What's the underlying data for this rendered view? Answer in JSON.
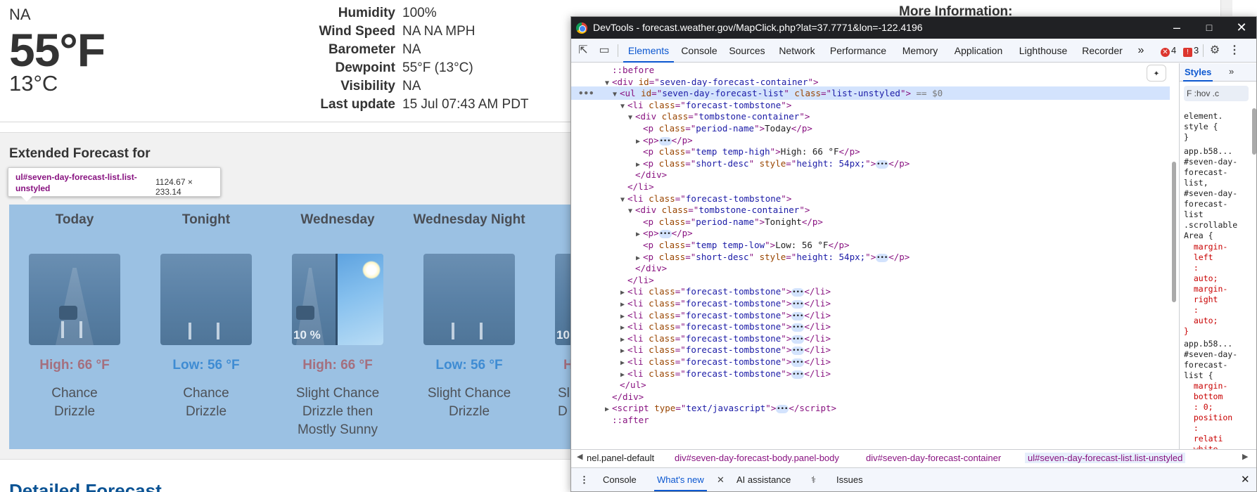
{
  "current": {
    "condition": "NA",
    "temp_f": "55°F",
    "temp_c": "13°C",
    "details": [
      {
        "label": "Humidity",
        "value": "100%"
      },
      {
        "label": "Wind Speed",
        "value": "NA NA MPH"
      },
      {
        "label": "Barometer",
        "value": "NA"
      },
      {
        "label": "Dewpoint",
        "value": "55°F (13°C)"
      },
      {
        "label": "Visibility",
        "value": "NA"
      },
      {
        "label": "Last update",
        "value": "15 Jul 07:43 AM PDT"
      }
    ],
    "more_info": "More Information:"
  },
  "extended": {
    "title": "Extended Forecast for",
    "tooltip_selector": "ul#seven-day-forecast-list.list-unstyled",
    "tooltip_size": "1124.67 × 233.14",
    "periods": [
      {
        "name": "Today",
        "temp": "High: 66 °F",
        "temp_type": "high",
        "desc": "Chance Drizzle",
        "pop": ""
      },
      {
        "name": "Tonight",
        "temp": "Low: 56 °F",
        "temp_type": "low",
        "desc": "Chance Drizzle",
        "pop": ""
      },
      {
        "name": "Wednesday",
        "temp": "High: 66 °F",
        "temp_type": "high",
        "desc": "Slight Chance Drizzle then Mostly Sunny",
        "pop": "10 %"
      },
      {
        "name": "Wednesday Night",
        "temp": "Low: 56 °F",
        "temp_type": "low",
        "desc": "Slight Chance Drizzle",
        "pop": ""
      },
      {
        "name": "",
        "temp": "H",
        "temp_type": "high",
        "desc": "Sl D",
        "pop": "10"
      }
    ]
  },
  "detailed": {
    "title": "Detailed Forecast"
  },
  "devtools": {
    "window_title": "DevTools - forecast.weather.gov/MapClick.php?lat=37.7771&lon=-122.4196",
    "tabs": [
      "Elements",
      "Console",
      "Sources",
      "Network",
      "Performance",
      "Memory",
      "Application",
      "Lighthouse",
      "Recorder"
    ],
    "more_tabs": "»",
    "error_count": "4",
    "issue_count": "3",
    "dom_lines": [
      {
        "indent": 4,
        "tw": "",
        "html": "::before",
        "sel": false,
        "kind": "pseudo"
      },
      {
        "indent": 4,
        "tw": "▼",
        "tag": "div",
        "attrs": [
          [
            "id",
            "seven-day-forecast-container"
          ]
        ],
        "end": false,
        "sel": false
      },
      {
        "indent": 5,
        "tw": "▼",
        "tag": "ul",
        "attrs": [
          [
            "id",
            "seven-day-forecast-list"
          ],
          [
            "class",
            "list-unstyled"
          ]
        ],
        "end": false,
        "sel": true,
        "suffix": " == $0"
      },
      {
        "indent": 6,
        "tw": "▼",
        "tag": "li",
        "attrs": [
          [
            "class",
            "forecast-tombstone"
          ]
        ],
        "end": false,
        "sel": false
      },
      {
        "indent": 7,
        "tw": "▼",
        "tag": "div",
        "attrs": [
          [
            "class",
            "tombstone-container"
          ]
        ],
        "end": false,
        "sel": false
      },
      {
        "indent": 8,
        "tw": "",
        "tag": "p",
        "attrs": [
          [
            "class",
            "period-name"
          ]
        ],
        "text": "Today",
        "close": "p",
        "sel": false
      },
      {
        "indent": 8,
        "tw": "▶",
        "tag": "p",
        "attrs": [],
        "pill": true,
        "close": "p",
        "sel": false
      },
      {
        "indent": 8,
        "tw": "",
        "tag": "p",
        "attrs": [
          [
            "class",
            "temp temp-high"
          ]
        ],
        "text": "High: 66 °F",
        "close": "p",
        "sel": false
      },
      {
        "indent": 8,
        "tw": "▶",
        "tag": "p",
        "attrs": [
          [
            "class",
            "short-desc"
          ],
          [
            "style",
            "height: 54px;"
          ]
        ],
        "pill": true,
        "close": "p",
        "sel": false
      },
      {
        "indent": 7,
        "tw": "",
        "closeonly": "div",
        "sel": false
      },
      {
        "indent": 6,
        "tw": "",
        "closeonly": "li",
        "sel": false
      },
      {
        "indent": 6,
        "tw": "▼",
        "tag": "li",
        "attrs": [
          [
            "class",
            "forecast-tombstone"
          ]
        ],
        "end": false,
        "sel": false
      },
      {
        "indent": 7,
        "tw": "▼",
        "tag": "div",
        "attrs": [
          [
            "class",
            "tombstone-container"
          ]
        ],
        "end": false,
        "sel": false
      },
      {
        "indent": 8,
        "tw": "",
        "tag": "p",
        "attrs": [
          [
            "class",
            "period-name"
          ]
        ],
        "text": "Tonight",
        "close": "p",
        "sel": false
      },
      {
        "indent": 8,
        "tw": "▶",
        "tag": "p",
        "attrs": [],
        "pill": true,
        "close": "p",
        "sel": false
      },
      {
        "indent": 8,
        "tw": "",
        "tag": "p",
        "attrs": [
          [
            "class",
            "temp temp-low"
          ]
        ],
        "text": "Low: 56 °F",
        "close": "p",
        "sel": false
      },
      {
        "indent": 8,
        "tw": "▶",
        "tag": "p",
        "attrs": [
          [
            "class",
            "short-desc"
          ],
          [
            "style",
            "height: 54px;"
          ]
        ],
        "pill": true,
        "close": "p",
        "sel": false
      },
      {
        "indent": 7,
        "tw": "",
        "closeonly": "div",
        "sel": false
      },
      {
        "indent": 6,
        "tw": "",
        "closeonly": "li",
        "sel": false
      },
      {
        "indent": 6,
        "tw": "▶",
        "tag": "li",
        "attrs": [
          [
            "class",
            "forecast-tombstone"
          ]
        ],
        "pill": true,
        "close": "li",
        "sel": false
      },
      {
        "indent": 6,
        "tw": "▶",
        "tag": "li",
        "attrs": [
          [
            "class",
            "forecast-tombstone"
          ]
        ],
        "pill": true,
        "close": "li",
        "sel": false
      },
      {
        "indent": 6,
        "tw": "▶",
        "tag": "li",
        "attrs": [
          [
            "class",
            "forecast-tombstone"
          ]
        ],
        "pill": true,
        "close": "li",
        "sel": false
      },
      {
        "indent": 6,
        "tw": "▶",
        "tag": "li",
        "attrs": [
          [
            "class",
            "forecast-tombstone"
          ]
        ],
        "pill": true,
        "close": "li",
        "sel": false
      },
      {
        "indent": 6,
        "tw": "▶",
        "tag": "li",
        "attrs": [
          [
            "class",
            "forecast-tombstone"
          ]
        ],
        "pill": true,
        "close": "li",
        "sel": false
      },
      {
        "indent": 6,
        "tw": "▶",
        "tag": "li",
        "attrs": [
          [
            "class",
            "forecast-tombstone"
          ]
        ],
        "pill": true,
        "close": "li",
        "sel": false
      },
      {
        "indent": 6,
        "tw": "▶",
        "tag": "li",
        "attrs": [
          [
            "class",
            "forecast-tombstone"
          ]
        ],
        "pill": true,
        "close": "li",
        "sel": false
      },
      {
        "indent": 6,
        "tw": "▶",
        "tag": "li",
        "attrs": [
          [
            "class",
            "forecast-tombstone"
          ]
        ],
        "pill": true,
        "close": "li",
        "sel": false
      },
      {
        "indent": 5,
        "tw": "",
        "closeonly": "ul",
        "sel": false
      },
      {
        "indent": 4,
        "tw": "",
        "closeonly": "div",
        "sel": false
      },
      {
        "indent": 4,
        "tw": "▶",
        "tag": "script",
        "attrs": [
          [
            "type",
            "text/javascript"
          ]
        ],
        "pill": true,
        "close": "script",
        "sel": false
      },
      {
        "indent": 4,
        "tw": "",
        "html": "::after",
        "sel": false,
        "kind": "pseudo"
      }
    ],
    "styles": {
      "tab": "Styles",
      "more": "»",
      "filter": "F  :hov  .c",
      "blocks": [
        "element.\nstyle {\n}",
        "app.b58...\n#seven-day-\nforecast-\nlist,\n#seven-day-\nforecast-\nlist\n.scrollable\nArea {",
        "  margin-\n  left\n  :\n  auto;\n  margin-\n  right\n  :\n  auto;\n}",
        "app.b58...\n#seven-day-\nforecast-\nlist {",
        "  margin-\n  bottom\n  : 0;\n  position\n  :\n  relati\n  white-"
      ]
    },
    "breadcrumbs": [
      "nel.panel-default",
      "div#seven-day-forecast-body.panel-body",
      "div#seven-day-forecast-container",
      "ul#seven-day-forecast-list.list-unstyled"
    ],
    "drawer_tabs": [
      "Console",
      "What's new",
      "AI assistance",
      "Issues"
    ]
  },
  "colors": {
    "selection": "#6fa8dc",
    "high": "#a56f7e",
    "low": "#3f8cd3",
    "devtools_accent": "#0b57d0"
  }
}
